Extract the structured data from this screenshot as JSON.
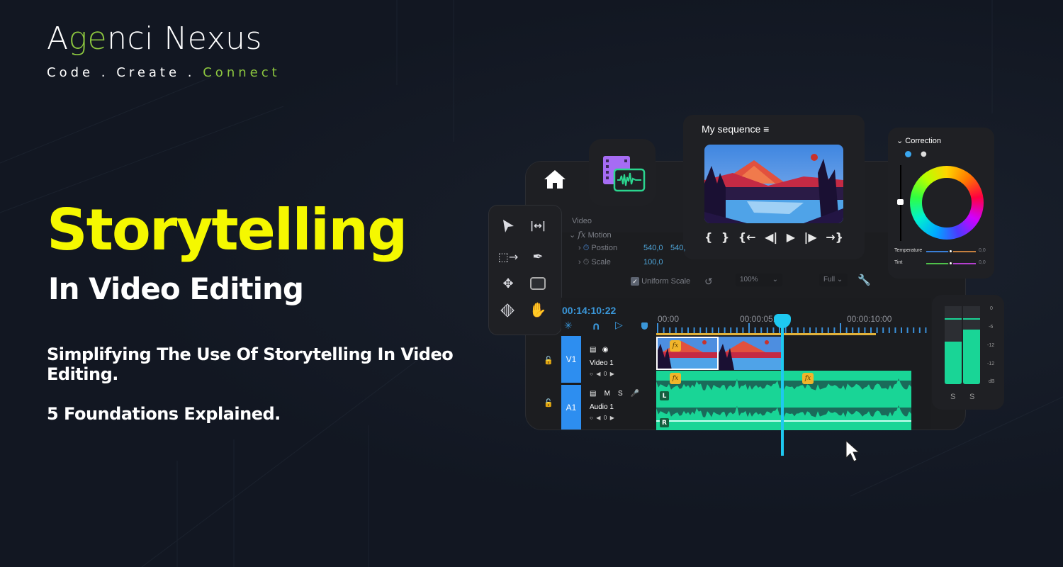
{
  "brand": {
    "name_prefix": "A",
    "name_mark": "ge",
    "name_suffix": "nci Nexus",
    "tagline_part1": "Code . Create . ",
    "tagline_part2": "Connect",
    "accent_color": "#8cc63f"
  },
  "hero": {
    "title": "Storytelling",
    "subtitle": "In Video Editing",
    "description": "Simplifying The Use Of Storytelling In Video Editing.",
    "foundations": "5 Foundations Explained.",
    "title_color": "#f5f800"
  },
  "editor": {
    "sequence": {
      "title": "My sequence",
      "menu_icon": "hamburger-icon",
      "controls": [
        "mark-in",
        "mark-out",
        "go-to-in",
        "step-back",
        "play",
        "step-forward",
        "go-to-out"
      ]
    },
    "effect_controls": {
      "section": "Video",
      "effect": "Motion",
      "position_label": "Postion",
      "position_x": "540,0",
      "position_y": "540,",
      "scale_label": "Scale",
      "scale_value": "100,0",
      "uniform_scale_label": "Uniform Scale",
      "uniform_scale_checked": true,
      "zoom_select": "100%",
      "quality_select": "Full"
    },
    "correction": {
      "title": "Correction",
      "temperature_label": "Temperature",
      "temperature_value": "0,0",
      "tint_label": "Tint",
      "tint_value": "0,0",
      "temperature_level": 0.5,
      "tint_level": 0.5,
      "luma_level": 0.5
    },
    "tools": [
      "selection-tool",
      "ripple-edit-tool",
      "track-select-tool",
      "pen-tool",
      "move-tool",
      "rectangle-tool",
      "razor-tool",
      "hand-tool"
    ],
    "timeline": {
      "timecode": "00:14:10:22",
      "ruler_labels": [
        "00:00",
        "00:00:05:00",
        "00:00:10:00"
      ],
      "tracks": [
        {
          "tag": "V1",
          "name": "Video 1",
          "value": "0"
        },
        {
          "tag": "A1",
          "name": "Audio 1",
          "value": "0",
          "buttons": [
            "M",
            "S"
          ]
        }
      ],
      "channel_labels": [
        "L",
        "R"
      ],
      "fx_label": "fx",
      "playhead_seconds": 6.8
    },
    "meter": {
      "scale": [
        "0",
        "-6",
        "-12",
        "-12",
        "dB"
      ],
      "solo_labels": [
        "S",
        "S"
      ],
      "left_level": 0.55,
      "right_level": 0.7
    }
  }
}
